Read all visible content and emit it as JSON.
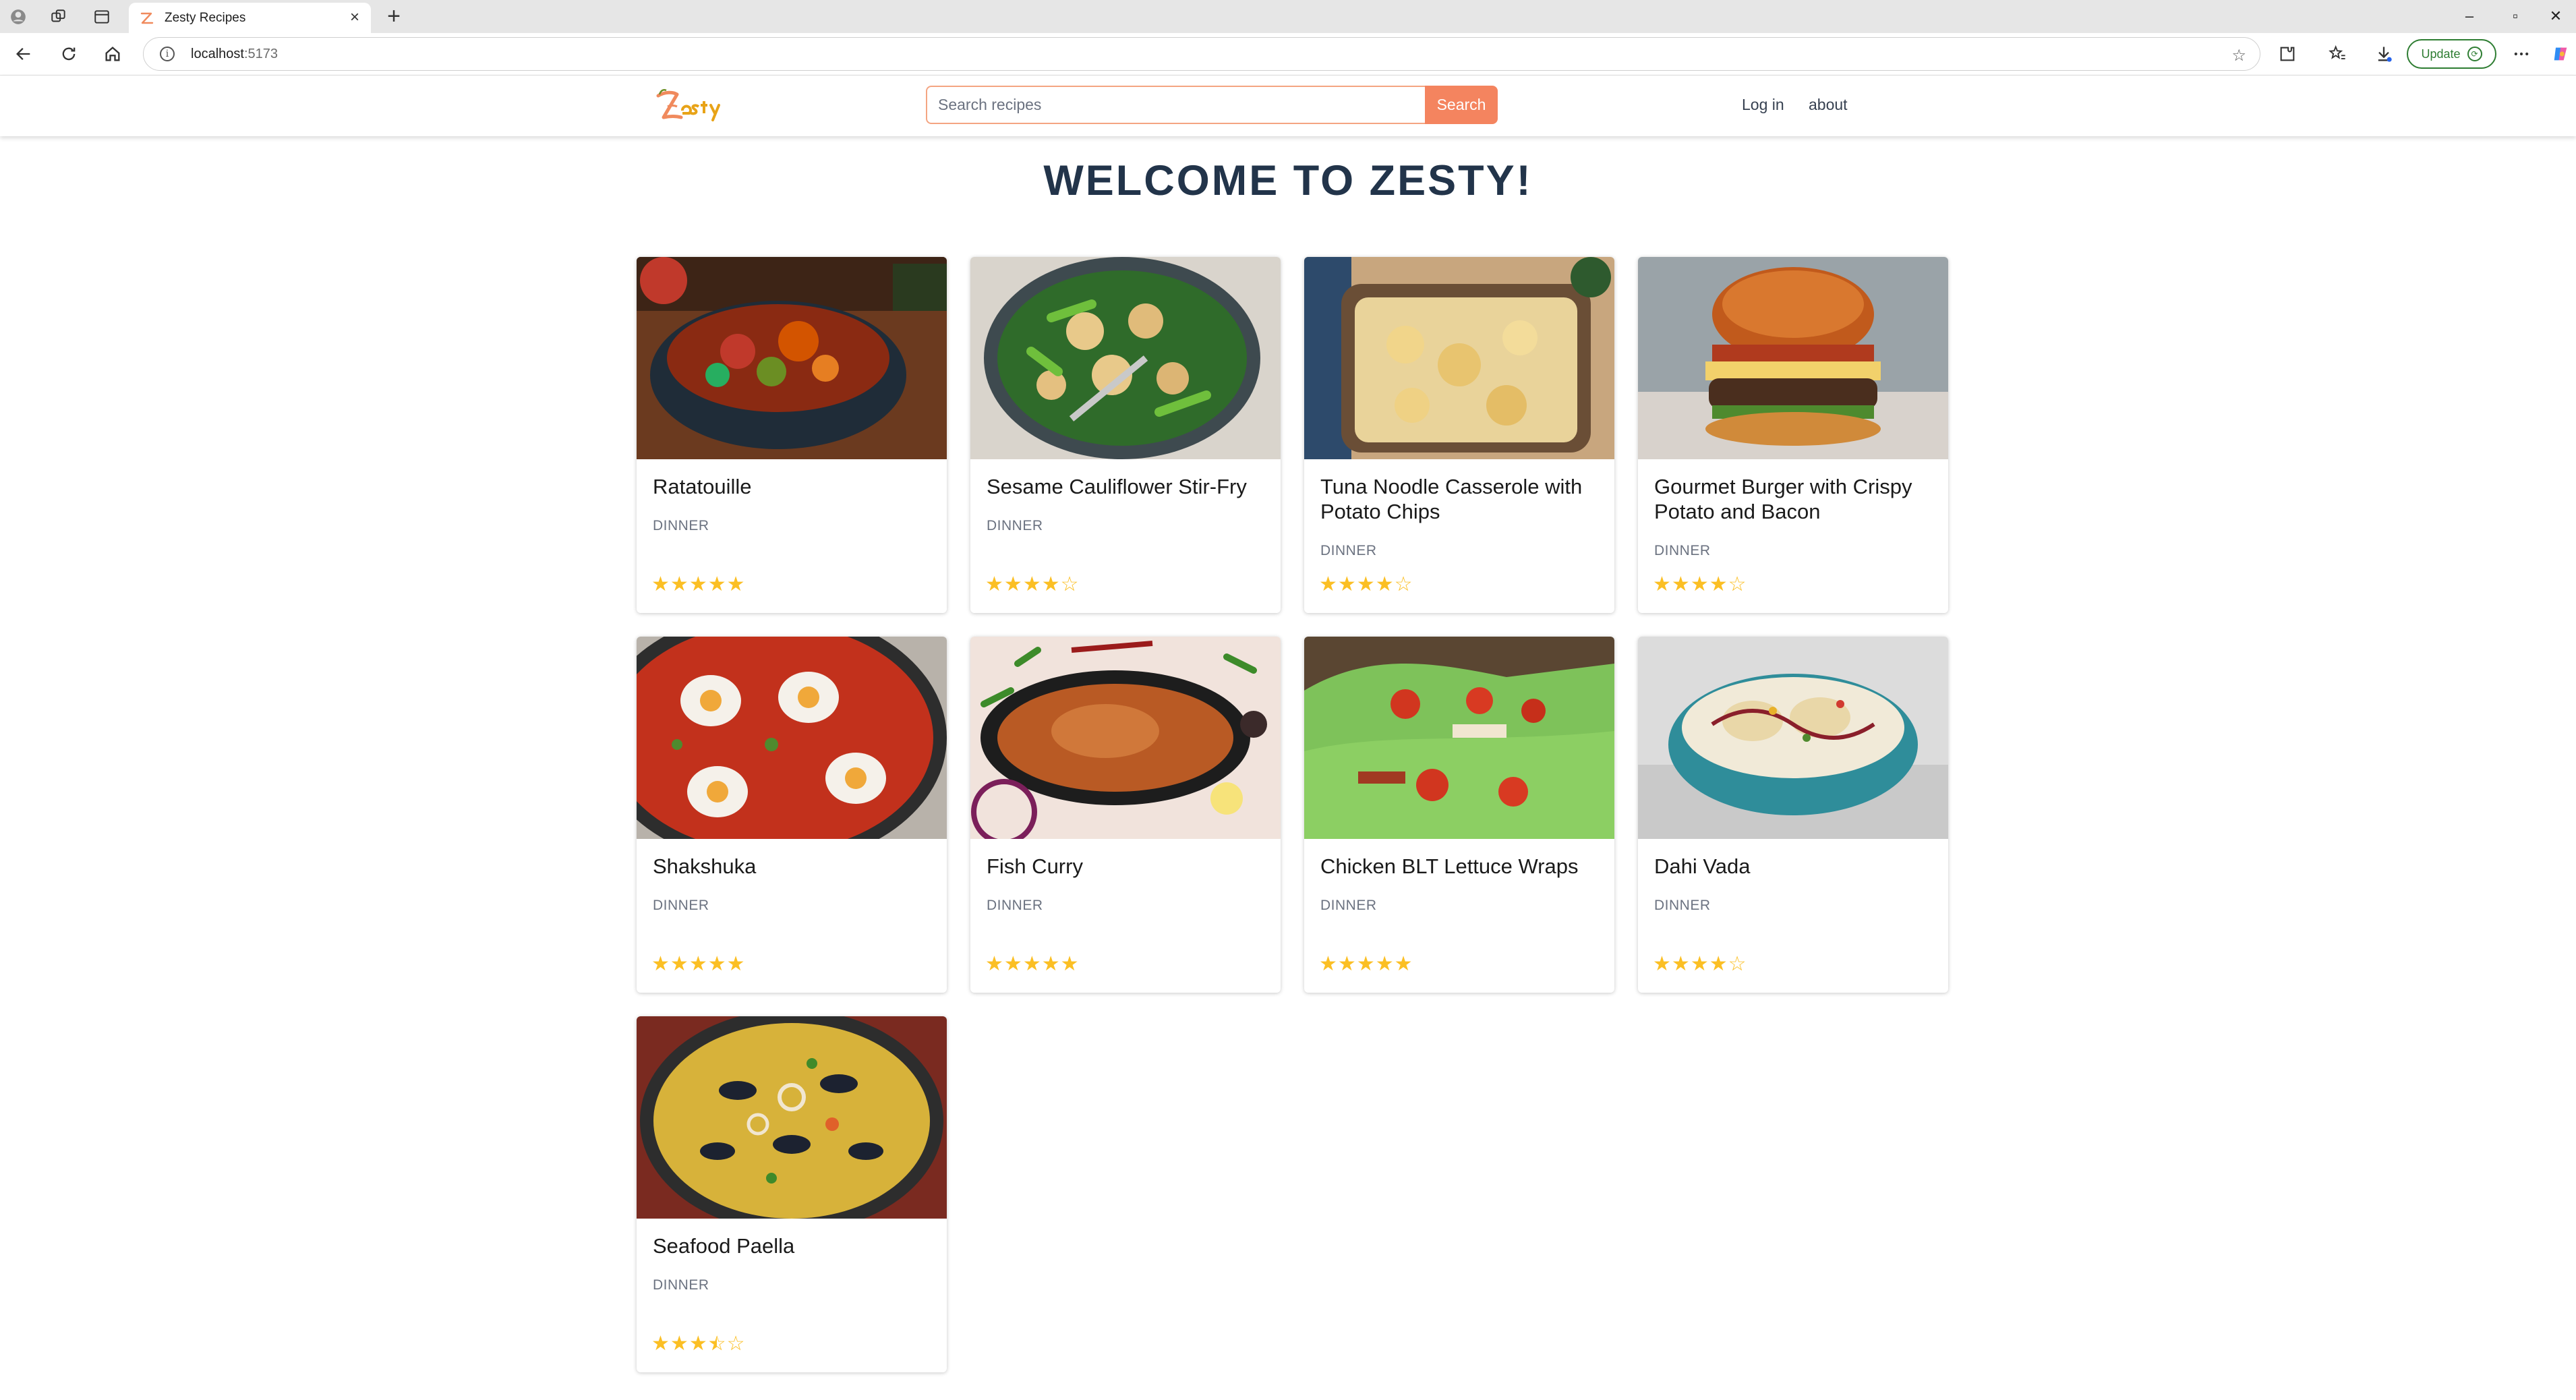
{
  "browser": {
    "tab_title": "Zesty Recipes",
    "url_host": "localhost",
    "url_port": ":5173",
    "update_label": "Update"
  },
  "header": {
    "search_placeholder": "Search recipes",
    "search_button": "Search",
    "login": "Log in",
    "about": "about"
  },
  "main": {
    "welcome": "WELCOME TO ZESTY!"
  },
  "recipes": [
    {
      "title": "Ratatouille",
      "category": "DINNER",
      "rating": 5,
      "image": "ratatouille-stew-in-dark-pot"
    },
    {
      "title": "Sesame Cauliflower Stir-Fry",
      "category": "DINNER",
      "rating": 4,
      "image": "cauliflower-snap-pea-stir-fry"
    },
    {
      "title": "Tuna Noodle Casserole with Potato Chips",
      "category": "DINNER",
      "rating": 4,
      "image": "casserole-with-chips"
    },
    {
      "title": "Gourmet Burger with Crispy Potato and Bacon",
      "category": "DINNER",
      "rating": 4,
      "image": "burger"
    },
    {
      "title": "Shakshuka",
      "category": "DINNER",
      "rating": 5,
      "image": "eggs-in-tomato-sauce"
    },
    {
      "title": "Fish Curry",
      "category": "DINNER",
      "rating": 5,
      "image": "fish-curry-in-skillet"
    },
    {
      "title": "Chicken BLT Lettuce Wraps",
      "category": "DINNER",
      "rating": 5,
      "image": "lettuce-wraps"
    },
    {
      "title": "Dahi Vada",
      "category": "DINNER",
      "rating": 4,
      "image": "dahi-vada-bowl"
    },
    {
      "title": "Seafood Paella",
      "category": "DINNER",
      "rating": 3.5,
      "image": "seafood-paella-pan"
    }
  ]
}
